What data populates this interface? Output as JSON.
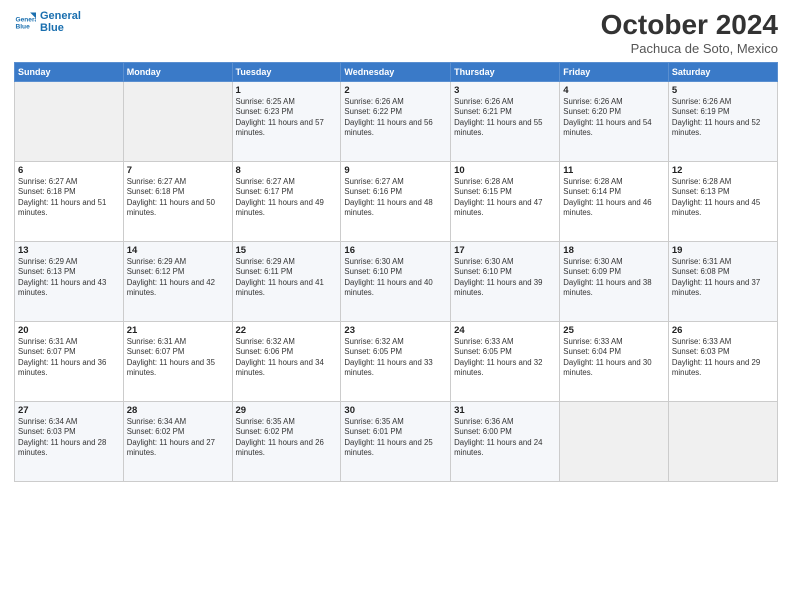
{
  "header": {
    "title": "October 2024",
    "subtitle": "Pachuca de Soto, Mexico"
  },
  "weekdays": [
    "Sunday",
    "Monday",
    "Tuesday",
    "Wednesday",
    "Thursday",
    "Friday",
    "Saturday"
  ],
  "weeks": [
    [
      {
        "day": "",
        "empty": true
      },
      {
        "day": "",
        "empty": true
      },
      {
        "day": "1",
        "sunrise": "Sunrise: 6:25 AM",
        "sunset": "Sunset: 6:23 PM",
        "daylight": "Daylight: 11 hours and 57 minutes."
      },
      {
        "day": "2",
        "sunrise": "Sunrise: 6:26 AM",
        "sunset": "Sunset: 6:22 PM",
        "daylight": "Daylight: 11 hours and 56 minutes."
      },
      {
        "day": "3",
        "sunrise": "Sunrise: 6:26 AM",
        "sunset": "Sunset: 6:21 PM",
        "daylight": "Daylight: 11 hours and 55 minutes."
      },
      {
        "day": "4",
        "sunrise": "Sunrise: 6:26 AM",
        "sunset": "Sunset: 6:20 PM",
        "daylight": "Daylight: 11 hours and 54 minutes."
      },
      {
        "day": "5",
        "sunrise": "Sunrise: 6:26 AM",
        "sunset": "Sunset: 6:19 PM",
        "daylight": "Daylight: 11 hours and 52 minutes."
      }
    ],
    [
      {
        "day": "6",
        "sunrise": "Sunrise: 6:27 AM",
        "sunset": "Sunset: 6:18 PM",
        "daylight": "Daylight: 11 hours and 51 minutes."
      },
      {
        "day": "7",
        "sunrise": "Sunrise: 6:27 AM",
        "sunset": "Sunset: 6:18 PM",
        "daylight": "Daylight: 11 hours and 50 minutes."
      },
      {
        "day": "8",
        "sunrise": "Sunrise: 6:27 AM",
        "sunset": "Sunset: 6:17 PM",
        "daylight": "Daylight: 11 hours and 49 minutes."
      },
      {
        "day": "9",
        "sunrise": "Sunrise: 6:27 AM",
        "sunset": "Sunset: 6:16 PM",
        "daylight": "Daylight: 11 hours and 48 minutes."
      },
      {
        "day": "10",
        "sunrise": "Sunrise: 6:28 AM",
        "sunset": "Sunset: 6:15 PM",
        "daylight": "Daylight: 11 hours and 47 minutes."
      },
      {
        "day": "11",
        "sunrise": "Sunrise: 6:28 AM",
        "sunset": "Sunset: 6:14 PM",
        "daylight": "Daylight: 11 hours and 46 minutes."
      },
      {
        "day": "12",
        "sunrise": "Sunrise: 6:28 AM",
        "sunset": "Sunset: 6:13 PM",
        "daylight": "Daylight: 11 hours and 45 minutes."
      }
    ],
    [
      {
        "day": "13",
        "sunrise": "Sunrise: 6:29 AM",
        "sunset": "Sunset: 6:13 PM",
        "daylight": "Daylight: 11 hours and 43 minutes."
      },
      {
        "day": "14",
        "sunrise": "Sunrise: 6:29 AM",
        "sunset": "Sunset: 6:12 PM",
        "daylight": "Daylight: 11 hours and 42 minutes."
      },
      {
        "day": "15",
        "sunrise": "Sunrise: 6:29 AM",
        "sunset": "Sunset: 6:11 PM",
        "daylight": "Daylight: 11 hours and 41 minutes."
      },
      {
        "day": "16",
        "sunrise": "Sunrise: 6:30 AM",
        "sunset": "Sunset: 6:10 PM",
        "daylight": "Daylight: 11 hours and 40 minutes."
      },
      {
        "day": "17",
        "sunrise": "Sunrise: 6:30 AM",
        "sunset": "Sunset: 6:10 PM",
        "daylight": "Daylight: 11 hours and 39 minutes."
      },
      {
        "day": "18",
        "sunrise": "Sunrise: 6:30 AM",
        "sunset": "Sunset: 6:09 PM",
        "daylight": "Daylight: 11 hours and 38 minutes."
      },
      {
        "day": "19",
        "sunrise": "Sunrise: 6:31 AM",
        "sunset": "Sunset: 6:08 PM",
        "daylight": "Daylight: 11 hours and 37 minutes."
      }
    ],
    [
      {
        "day": "20",
        "sunrise": "Sunrise: 6:31 AM",
        "sunset": "Sunset: 6:07 PM",
        "daylight": "Daylight: 11 hours and 36 minutes."
      },
      {
        "day": "21",
        "sunrise": "Sunrise: 6:31 AM",
        "sunset": "Sunset: 6:07 PM",
        "daylight": "Daylight: 11 hours and 35 minutes."
      },
      {
        "day": "22",
        "sunrise": "Sunrise: 6:32 AM",
        "sunset": "Sunset: 6:06 PM",
        "daylight": "Daylight: 11 hours and 34 minutes."
      },
      {
        "day": "23",
        "sunrise": "Sunrise: 6:32 AM",
        "sunset": "Sunset: 6:05 PM",
        "daylight": "Daylight: 11 hours and 33 minutes."
      },
      {
        "day": "24",
        "sunrise": "Sunrise: 6:33 AM",
        "sunset": "Sunset: 6:05 PM",
        "daylight": "Daylight: 11 hours and 32 minutes."
      },
      {
        "day": "25",
        "sunrise": "Sunrise: 6:33 AM",
        "sunset": "Sunset: 6:04 PM",
        "daylight": "Daylight: 11 hours and 30 minutes."
      },
      {
        "day": "26",
        "sunrise": "Sunrise: 6:33 AM",
        "sunset": "Sunset: 6:03 PM",
        "daylight": "Daylight: 11 hours and 29 minutes."
      }
    ],
    [
      {
        "day": "27",
        "sunrise": "Sunrise: 6:34 AM",
        "sunset": "Sunset: 6:03 PM",
        "daylight": "Daylight: 11 hours and 28 minutes."
      },
      {
        "day": "28",
        "sunrise": "Sunrise: 6:34 AM",
        "sunset": "Sunset: 6:02 PM",
        "daylight": "Daylight: 11 hours and 27 minutes."
      },
      {
        "day": "29",
        "sunrise": "Sunrise: 6:35 AM",
        "sunset": "Sunset: 6:02 PM",
        "daylight": "Daylight: 11 hours and 26 minutes."
      },
      {
        "day": "30",
        "sunrise": "Sunrise: 6:35 AM",
        "sunset": "Sunset: 6:01 PM",
        "daylight": "Daylight: 11 hours and 25 minutes."
      },
      {
        "day": "31",
        "sunrise": "Sunrise: 6:36 AM",
        "sunset": "Sunset: 6:00 PM",
        "daylight": "Daylight: 11 hours and 24 minutes."
      },
      {
        "day": "",
        "empty": true
      },
      {
        "day": "",
        "empty": true
      }
    ]
  ]
}
